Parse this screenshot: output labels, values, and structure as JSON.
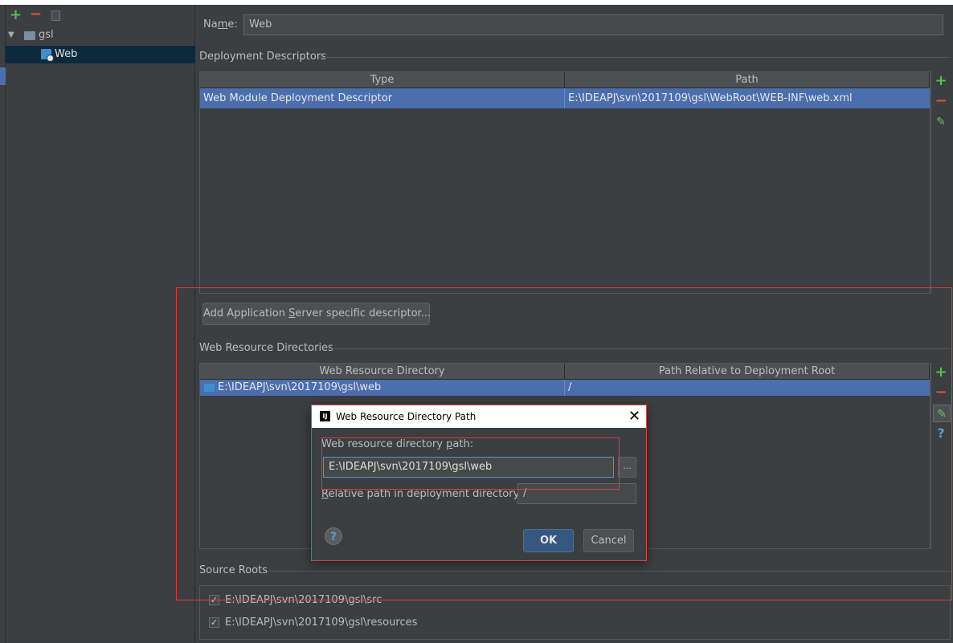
{
  "tree": {
    "root_label": "gsl",
    "child_label": "Web"
  },
  "facet": {
    "name_label_pre": "Na",
    "name_label_mn": "m",
    "name_label_post": "e:",
    "name_value": "Web"
  },
  "deployment_descriptors": {
    "title": "Deployment Descriptors",
    "columns": [
      "Type",
      "Path"
    ],
    "rows": [
      {
        "type": "Web Module Deployment Descriptor",
        "path": "E:\\IDEAPJ\\svn\\2017109\\gsl\\WebRoot\\WEB-INF\\web.xml"
      }
    ]
  },
  "add_server_button": {
    "pre": "Add Application ",
    "mn": "S",
    "post": "erver specific descriptor..."
  },
  "web_resource_directories": {
    "title": "Web Resource Directories",
    "columns": [
      "Web Resource Directory",
      "Path Relative to Deployment Root"
    ],
    "rows": [
      {
        "directory": "E:\\IDEAPJ\\svn\\2017109\\gsl\\web",
        "relative": "/"
      }
    ]
  },
  "dialog": {
    "title": "Web Resource Directory Path",
    "path_label_pre": "Web resource directory ",
    "path_label_mn": "p",
    "path_label_post": "ath:",
    "path_value": "E:\\IDEAPJ\\svn\\2017109\\gsl\\web",
    "browse_label": "...",
    "relative_label_mn": "R",
    "relative_label_post": "elative path in deployment directory:",
    "relative_value": "/",
    "ok_label": "OK",
    "cancel_label": "Cancel",
    "help_label": "?"
  },
  "source_roots": {
    "title": "Source Roots",
    "items": [
      {
        "label": "E:\\IDEAPJ\\svn\\2017109\\gsl\\src",
        "checked": true
      },
      {
        "label": "E:\\IDEAPJ\\svn\\2017109\\gsl\\resources",
        "checked": true
      }
    ]
  },
  "icons": {
    "add": "plus-icon",
    "remove": "minus-icon",
    "copy": "copy-icon",
    "edit": "pencil-icon",
    "help": "question-icon"
  },
  "colors": {
    "selection": "#4b6eaf",
    "add_green": "#4fc24f",
    "remove_red": "#e2503f",
    "highlight_red": "#e0383e"
  }
}
